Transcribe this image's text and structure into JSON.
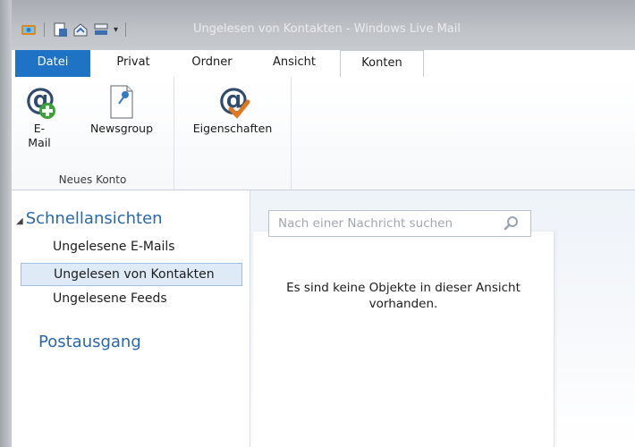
{
  "window": {
    "title": "Ungelesen von Kontakten - Windows Live Mail"
  },
  "tabs": [
    {
      "label": "Datei"
    },
    {
      "label": "Privat"
    },
    {
      "label": "Ordner"
    },
    {
      "label": "Ansicht"
    },
    {
      "label": "Konten"
    }
  ],
  "ribbon": {
    "new_account_group": {
      "label": "Neues Konto",
      "email_label_1": "E-",
      "email_label_2": "Mail",
      "newsgroup_label": "Newsgroup"
    },
    "properties_label": "Eigenschaften"
  },
  "nav": {
    "header": "Schnellansichten",
    "items": [
      {
        "label": "Ungelesene E-Mails"
      },
      {
        "label": "Ungelesen von Kontakten"
      },
      {
        "label": "Ungelesene Feeds"
      }
    ],
    "outbox": "Postausgang"
  },
  "search": {
    "placeholder": "Nach einer Nachricht suchen"
  },
  "message_list": {
    "empty_text_1": "Es sind keine Objekte in dieser Ansicht",
    "empty_text_2": "vorhanden."
  },
  "colors": {
    "accent": "#1e73c4",
    "nav_header": "#2a67a8",
    "selected_bg": "#dfeaf7"
  }
}
